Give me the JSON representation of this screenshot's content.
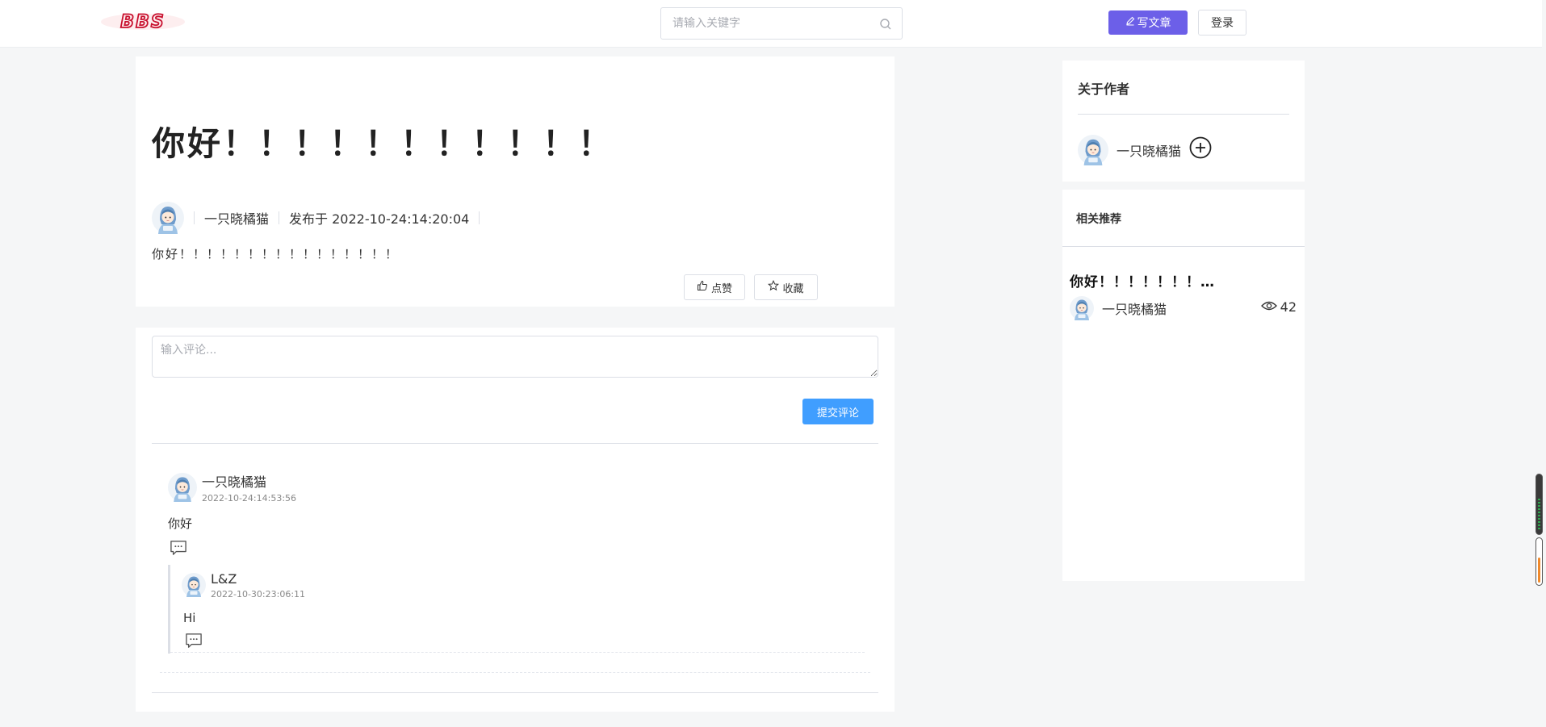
{
  "header": {
    "logo_text": "BBS",
    "search_placeholder": "请输入关键字",
    "write_label": "写文章",
    "login_label": "登录"
  },
  "article": {
    "title": "你好！！！！！！！！！！！",
    "author": "一只晓橘猫",
    "published": "发布于 2022-10-24:14:20:04",
    "body": "你好！！！！！！！！！！！！！！！！",
    "like_label": "点赞",
    "favorite_label": "收藏"
  },
  "comments": {
    "input_placeholder": "输入评论...",
    "submit_label": "提交评论",
    "items": [
      {
        "author": "一只晓橘猫",
        "time": "2022-10-24:14:53:56",
        "text": "你好",
        "replies": [
          {
            "author": "L&Z",
            "time": "2022-10-30:23:06:11",
            "text": "Hi"
          }
        ]
      }
    ]
  },
  "sidebar": {
    "about_title": "关于作者",
    "author_name": "一只晓橘猫",
    "recommend_title": "相关推荐",
    "recommend_items": [
      {
        "title": "你好！！！！！！！…",
        "author": "一只晓橘猫",
        "views": "42"
      }
    ]
  },
  "colors": {
    "primary": "#6c5fe8",
    "submit": "#409eff",
    "background": "#f5f6f7"
  }
}
